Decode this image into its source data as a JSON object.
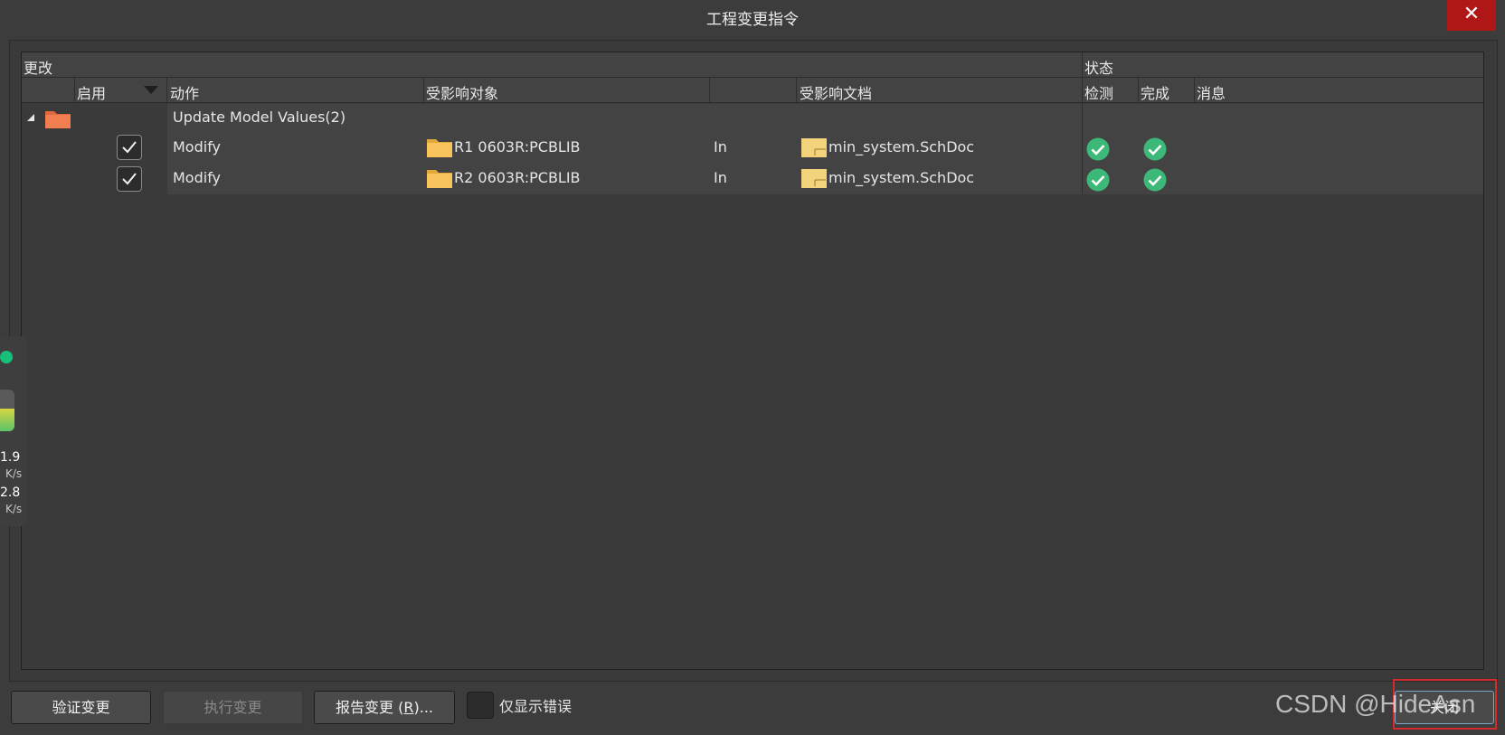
{
  "window": {
    "title": "工程变更指令",
    "close_glyph": "✕"
  },
  "table": {
    "group_headers": {
      "changes": "更改",
      "status": "状态"
    },
    "columns": {
      "enable": "启用",
      "action": "动作",
      "affected_object": "受影响对象",
      "affected_document": "受影响文档",
      "check": "检测",
      "done": "完成",
      "message": "消息"
    },
    "group": {
      "label": "Update Model Values(2)",
      "icon": "folder-icon"
    },
    "rows": [
      {
        "enabled": true,
        "action": "Modify",
        "object": "R1 0603R:PCBLIB",
        "direction": "In",
        "document": "min_system.SchDoc",
        "check": "ok",
        "done": "ok",
        "message": ""
      },
      {
        "enabled": true,
        "action": "Modify",
        "object": "R2 0603R:PCBLIB",
        "direction": "In",
        "document": "min_system.SchDoc",
        "check": "ok",
        "done": "ok",
        "message": ""
      }
    ]
  },
  "side_widget": {
    "value1": "1.9",
    "unit1": "K/s",
    "value2": "2.8",
    "unit2": "K/s",
    "level": 0.55
  },
  "buttons": {
    "validate": "验证变更",
    "execute": "执行变更",
    "report_prefix": "报告变更 (",
    "report_key": "R",
    "report_suffix": ")...",
    "only_errors": "仅显示错误",
    "close": "关闭"
  },
  "watermark": "CSDN @HideAsn",
  "colors": {
    "ok_green": "#3cb878",
    "close_red": "#b01818",
    "highlight": "#d42c2c"
  }
}
